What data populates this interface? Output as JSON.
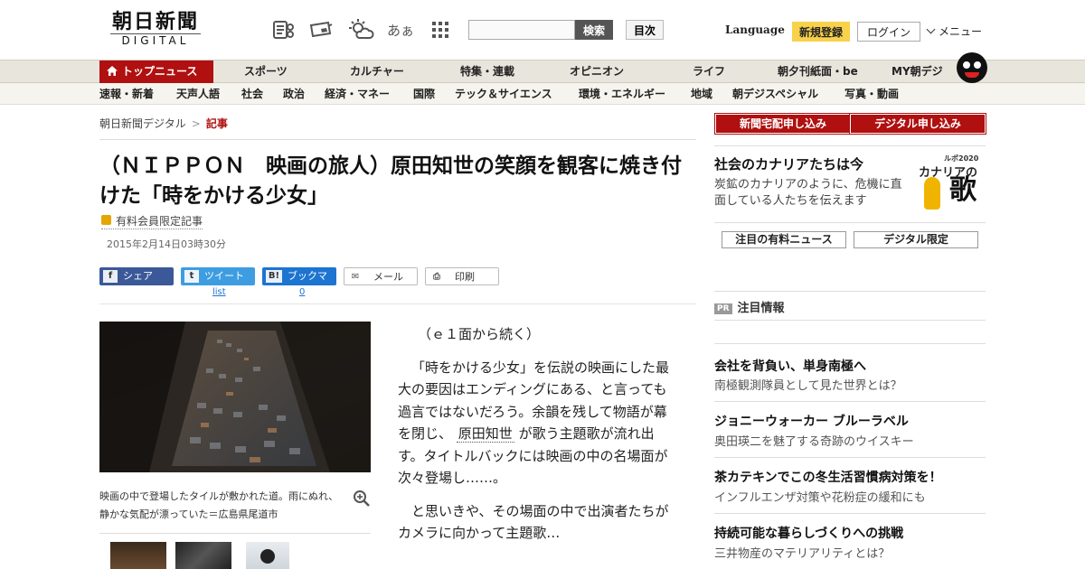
{
  "logo": {
    "main": "朝日新聞",
    "sub": "DIGITAL"
  },
  "header": {
    "search_button": "検索",
    "search_placeholder": "",
    "index_button": "目次",
    "language": "Language",
    "register": "新規登録",
    "login": "ログイン",
    "menu": "メニュー",
    "font_size_icon_text": "あぁ"
  },
  "nav_primary": {
    "top_news": "トップニュース",
    "items": [
      "スポーツ",
      "カルチャー",
      "特集・連載",
      "オピニオン",
      "ライフ",
      "朝夕刊紙面・be",
      "MY朝デジ"
    ]
  },
  "nav_secondary": {
    "items": [
      "速報・新着",
      "天声人語",
      "社会",
      "政治",
      "経済・マネー",
      "国際",
      "テック＆サイエンス",
      "環境・エネルギー",
      "地域",
      "朝デジスペシャル",
      "写真・動画"
    ]
  },
  "breadcrumb": {
    "home": "朝日新聞デジタル",
    "current": "記事"
  },
  "article": {
    "title": "（ＮＩＰＰＯＮ　映画の旅人）原田知世の笑顔を観客に焼き付けた「時をかける少女」",
    "paid_label": "有料会員限定記事",
    "date": "2015年2月14日03時30分",
    "share": {
      "facebook": "シェア",
      "twitter": "ツイート",
      "hatena": "ブックマーク",
      "mail": "メール",
      "print": "印刷",
      "twitter_count": "list",
      "hatena_count": "0"
    },
    "photo_caption": "映画の中で登場したタイルが敷かれた道。雨にぬれ、静かな気配が漂っていた＝広島県尾道市",
    "paragraphs": {
      "p1": "（ｅ１面から続く）",
      "p2_a": "「時をかける少女」を伝説の映画にした最大の要因はエンディングにある、と言っても過言ではないだろう。余韻を残して物語が幕を閉じ、",
      "p2_link": "原田知世",
      "p2_b": "が歌う主題歌が流れ出す。タイトルバックには映画の中の名場面が次々登場し……。",
      "p3": "と思いきや、その場面の中で出演者たちがカメラに向かって主題歌…"
    }
  },
  "sidebar": {
    "subscribe_paper": "新聞宅配申し込み",
    "subscribe_digital": "デジタル申し込み",
    "canary_title": "社会のカナリアたちは今",
    "canary_text": "炭鉱のカナリアのように、危機に直面している人たちを伝えます",
    "canary_img_small": "ルポ2020",
    "canary_img_main": "カナリアの",
    "canary_img_big": "歌",
    "tab_news": "注目の有料ニュース",
    "tab_digital": "デジタル限定",
    "pr_badge": "PR",
    "pr_head": "注目情報",
    "pr_items": [
      {
        "title": "会社を背負い、単身南極へ",
        "sub": "南極観測隊員として見た世界とは？"
      },
      {
        "title": "ジョニーウォーカー ブルーラベル",
        "sub": "奥田瑛二を魅了する奇跡のウイスキー"
      },
      {
        "title": "茶カテキンでこの冬生活習慣病対策を！",
        "sub": "インフルエンザ対策や花粉症の緩和にも"
      },
      {
        "title": "持続可能な暮らしづくりへの挑戦",
        "sub": "三井物産のマテリアリティとは？"
      }
    ]
  },
  "colors": {
    "brand_red": "#b01010",
    "register_yellow": "#f8d24a"
  }
}
